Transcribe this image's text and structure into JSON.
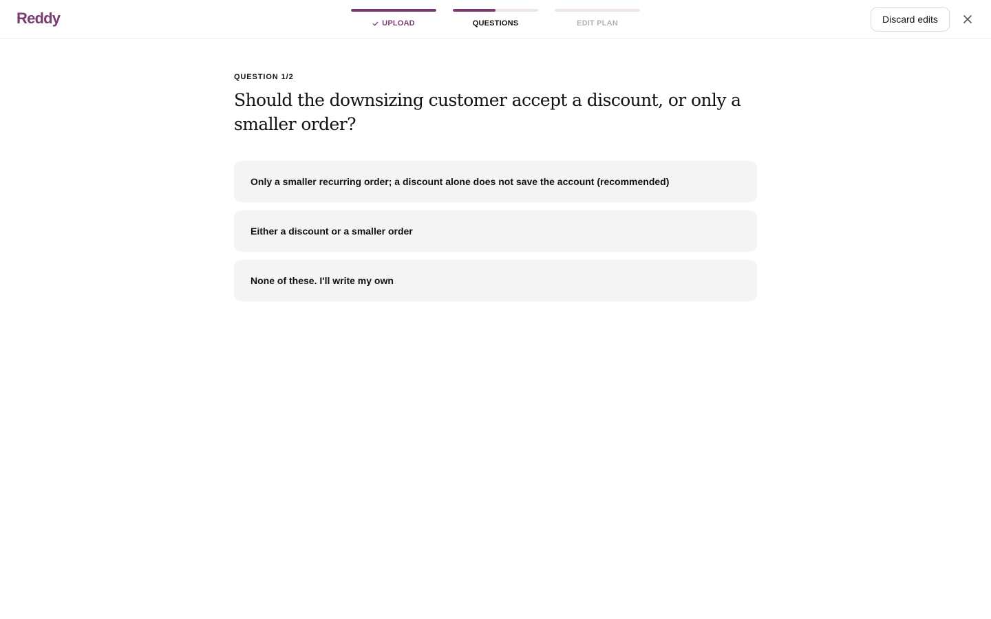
{
  "app": {
    "logo": "Reddy",
    "brand_color": "#7a3a72"
  },
  "steps": [
    {
      "label": "UPLOAD",
      "state": "done",
      "progress": 1.0,
      "icon": "check-icon"
    },
    {
      "label": "QUESTIONS",
      "state": "active",
      "progress": 0.5
    },
    {
      "label": "EDIT PLAN",
      "state": "todo",
      "progress": 0.0
    }
  ],
  "header": {
    "discard_label": "Discard edits",
    "close_icon": "close-icon"
  },
  "question": {
    "eyebrow": "QUESTION 1/2",
    "text": "Should the downsizing customer accept a discount, or only a smaller order?",
    "options": [
      "Only a smaller recurring order; a discount alone does not save the account (recommended)",
      "Either a discount or a smaller order",
      "None of these. I'll write my own"
    ]
  }
}
